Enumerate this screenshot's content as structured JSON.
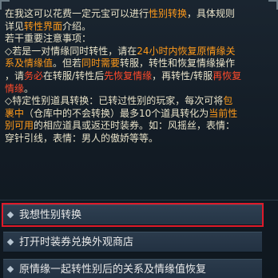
{
  "dialog": {
    "line1_a": "在我这可以花费一定元宝可以进行",
    "line1_hl": "性别转换",
    "line1_b": "，具体规则",
    "line2_a": "详见",
    "line2_hl": "转性界面",
    "line2_b": "介绍。",
    "line3": "若干重要注意事项：",
    "r1_a": "◇若是一对情缘同时转性，请在",
    "r1_hl": "24小时内恢复原情缘关",
    "r1_hl2": "系及情缘值",
    "r1_b": "。但若",
    "r1_hl3": "同时需要",
    "r1_c": "转服，转性和恢复情缘操作",
    "r1_d": "，请",
    "r1_red1": "务必",
    "r1_e": "在转服/转性后",
    "r1_red2": "先恢复情缘",
    "r1_f": "，再转性/转服",
    "r1_red3": "再恢复",
    "r1_red4": "情缘",
    "r1_g": "。",
    "r2_a": "◇特定性别道具转换：已转过性别的玩家，每次可将",
    "r2_hl1": "包",
    "r2_hl2": "裹中",
    "r2_b": "（仓库中的不会转换）最多10个道具转化为",
    "r2_hl3": "当前性",
    "r2_hl4": "别可用",
    "r2_c": "的相应道具或返还时装券。如：风摇丝，表情：",
    "r2_d": "穿针引线，表情：男人的傲娇等等。"
  },
  "options": [
    {
      "label": "我想性别转换",
      "selected": true
    },
    {
      "label": "打开时装券兑换外观商店",
      "selected": false
    },
    {
      "label": "原情缘一起转性别后的关系及情缘值恢复",
      "selected": false
    }
  ],
  "colors": {
    "highlight": "#ff9a1a",
    "warning": "#ff4a2a",
    "selection_border": "#e01a2a"
  },
  "icons": {
    "option_bullet": "diamond-bullet-icon"
  }
}
